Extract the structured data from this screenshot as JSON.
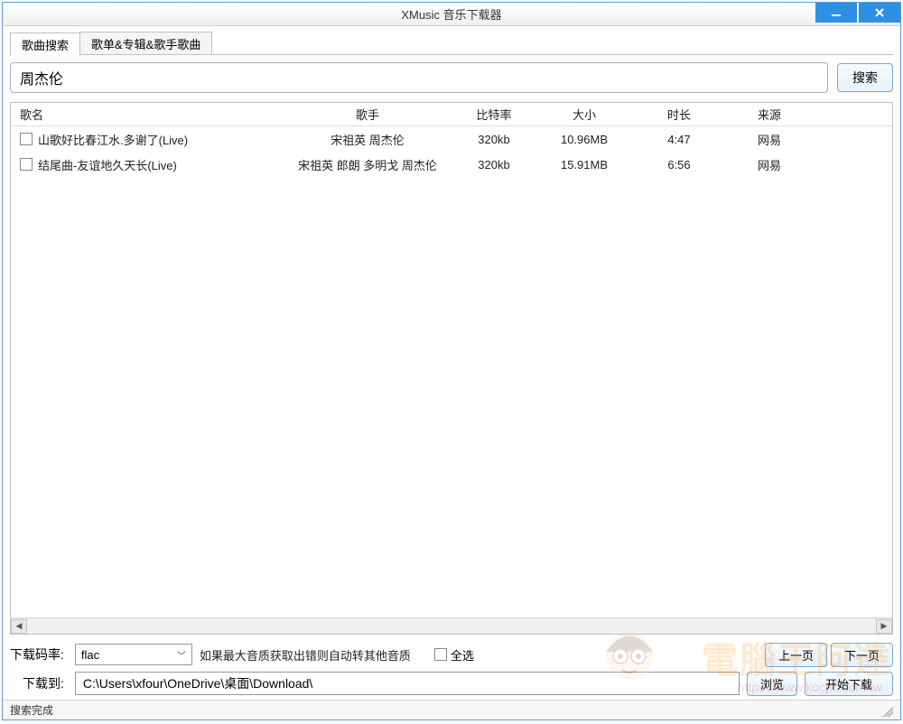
{
  "window": {
    "title": "XMusic 音乐下载器"
  },
  "tabs": [
    {
      "label": "歌曲搜索",
      "active": true
    },
    {
      "label": "歌单&专辑&歌手歌曲",
      "active": false
    }
  ],
  "search": {
    "value": "周杰伦",
    "button": "搜索"
  },
  "table": {
    "headers": {
      "name": "歌名",
      "artist": "歌手",
      "bitrate": "比特率",
      "size": "大小",
      "duration": "时长",
      "source": "来源"
    },
    "rows": [
      {
        "checked": false,
        "name": "山歌好比春江水.多谢了(Live)",
        "artist": "宋祖英 周杰伦",
        "bitrate": "320kb",
        "size": "10.96MB",
        "duration": "4:47",
        "source": "网易"
      },
      {
        "checked": false,
        "name": "结尾曲-友谊地久天长(Live)",
        "artist": "宋祖英 郎朗 多明戈 周杰伦",
        "bitrate": "320kb",
        "size": "15.91MB",
        "duration": "6:56",
        "source": "网易"
      }
    ]
  },
  "bottom": {
    "bitrate_label": "下载码率:",
    "bitrate_value": "flac",
    "note": "如果最大音质获取出错则自动转其他音质",
    "select_all": "全选",
    "prev_page": "上一页",
    "next_page": "下一页",
    "download_to_label": "下载到:",
    "download_path": "C:\\Users\\xfour\\OneDrive\\桌面\\Download\\",
    "browse": "浏览",
    "start_download": "开始下载"
  },
  "status": "搜索完成",
  "watermark": {
    "text": "電腦王阿達",
    "url": "https://www.kocpc.com.tw"
  }
}
